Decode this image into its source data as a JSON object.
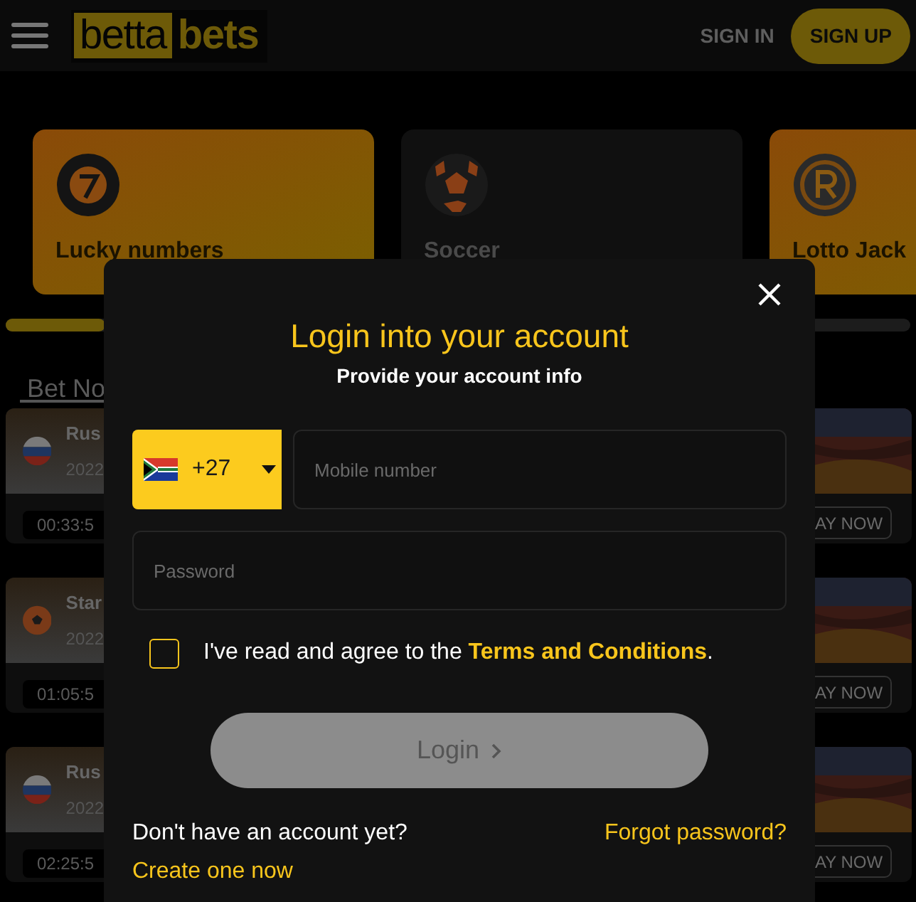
{
  "header": {
    "logo_left": "betta",
    "logo_right": "bets",
    "sign_in": "SIGN IN",
    "sign_up": "SIGN UP"
  },
  "categories": [
    {
      "title": "Lucky numbers",
      "kind": "lucky"
    },
    {
      "title": "Soccer",
      "kind": "soccer"
    },
    {
      "title": "Lotto Jack",
      "kind": "lotto"
    }
  ],
  "tab": {
    "label": "Bet No"
  },
  "matches": [
    {
      "name": "Rus",
      "date": "2022",
      "timer": "00:33:5",
      "button": "AY NOW",
      "kind": "flag"
    },
    {
      "name": "Star",
      "date": "2022",
      "timer": "01:05:5",
      "button": "AY NOW",
      "kind": "ball"
    },
    {
      "name": "Rus",
      "date": "2022",
      "timer": "02:25:5",
      "button": "AY NOW",
      "kind": "flag"
    }
  ],
  "modal": {
    "title": "Login into your account",
    "subtitle": "Provide your account info",
    "country_code": "+27",
    "mobile": {
      "placeholder": "Mobile number"
    },
    "password": {
      "placeholder": "Password"
    },
    "terms": {
      "checked": false,
      "text": "I've read and agree to the ",
      "link": "Terms and Conditions",
      "suffix": "."
    },
    "login": {
      "label": "Login",
      "disabled": true
    },
    "no_account": "Don't have an account yet?",
    "create": "Create one now",
    "forgot": "Forgot password?"
  }
}
